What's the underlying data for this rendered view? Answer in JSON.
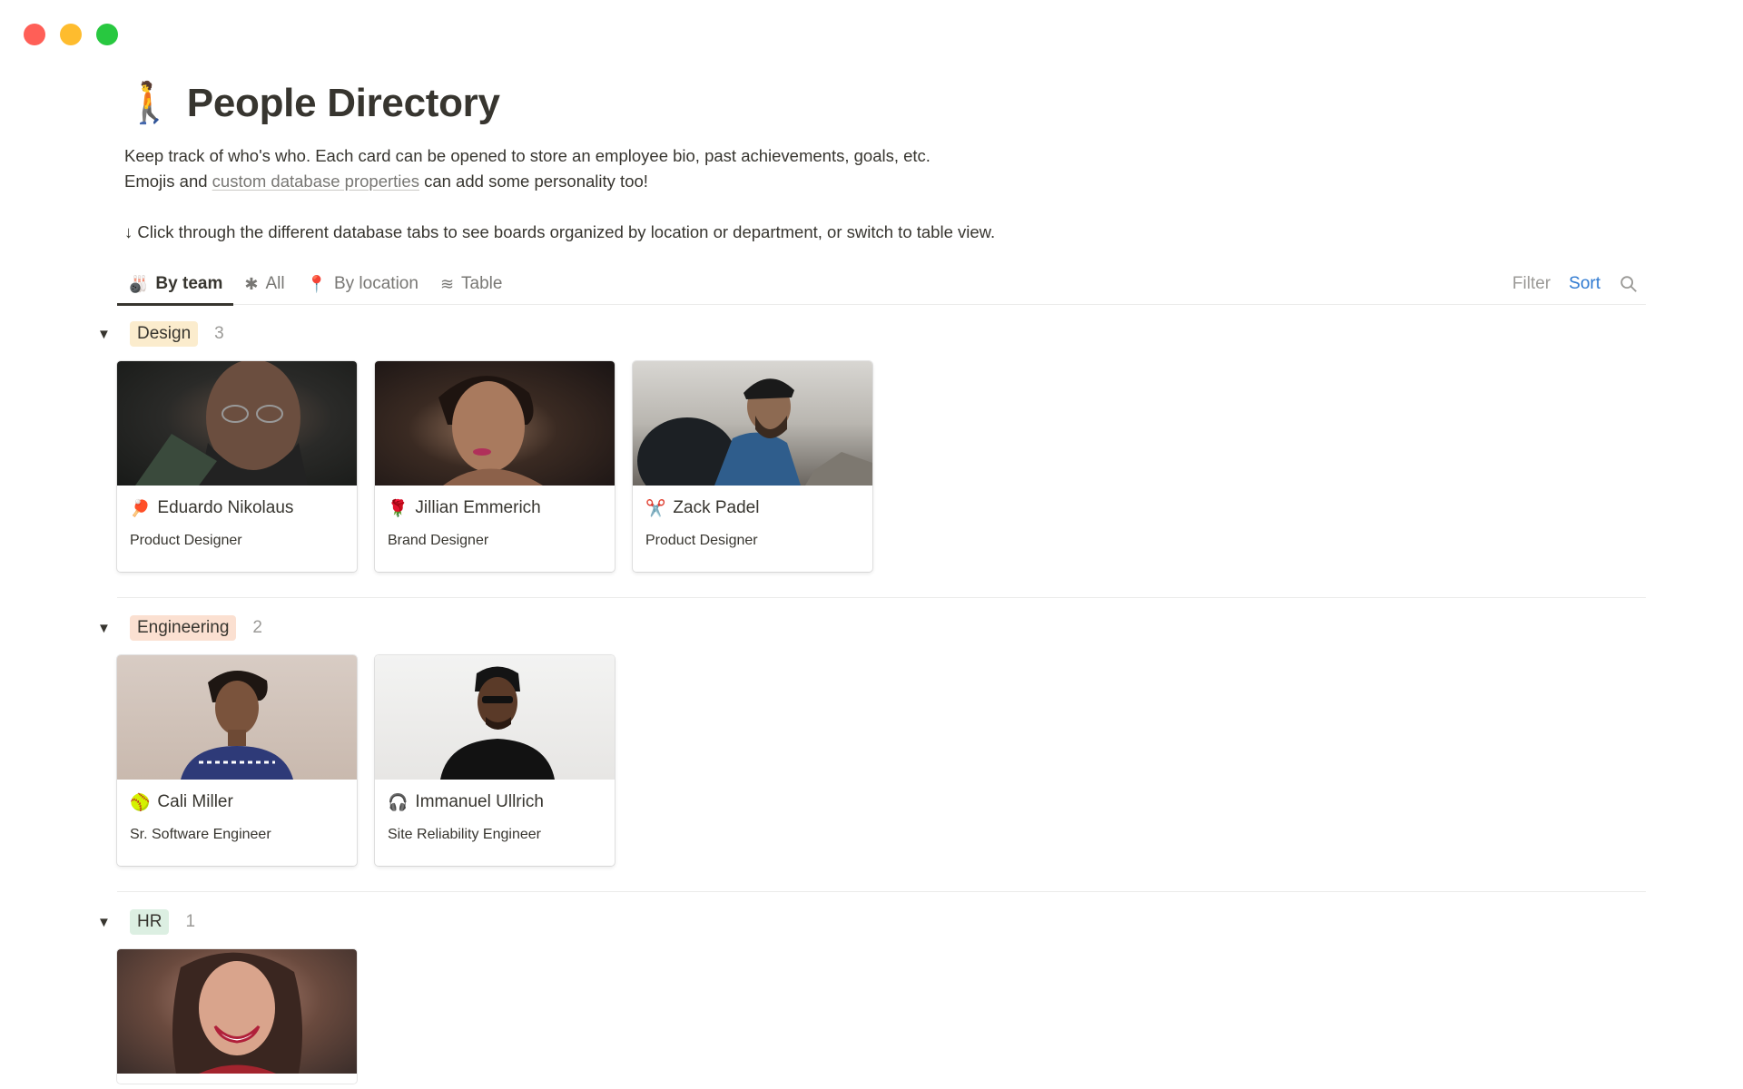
{
  "page": {
    "title_icon": "🚶",
    "title": "People Directory",
    "desc_line1": "Keep track of who's who. Each card can be opened to store an employee bio, past achievements, goals, etc.",
    "desc_line2_pre": "Emojis and ",
    "desc_line2_link": "custom database properties",
    "desc_line2_post": " can add some personality too!",
    "desc_line3": "↓ Click through the different database tabs to see boards organized by location or department, or switch to table view."
  },
  "tabs": [
    {
      "label": "By team",
      "icon": "🎳",
      "active": true
    },
    {
      "label": "All",
      "icon": "✱",
      "active": false
    },
    {
      "label": "By location",
      "icon": "📍",
      "active": false
    },
    {
      "label": "Table",
      "icon": "≋",
      "active": false
    }
  ],
  "actions": {
    "filter": "Filter",
    "sort": "Sort",
    "search_icon": "search-icon"
  },
  "groups": [
    {
      "name": "Design",
      "count": "3",
      "cards": [
        {
          "emoji": "🏓",
          "name": "Eduardo Nikolaus",
          "role": "Product Designer"
        },
        {
          "emoji": "🌹",
          "name": "Jillian Emmerich",
          "role": "Brand Designer"
        },
        {
          "emoji": "✂️",
          "name": "Zack Padel",
          "role": "Product Designer"
        }
      ]
    },
    {
      "name": "Engineering",
      "count": "2",
      "cards": [
        {
          "emoji": "🥎",
          "name": "Cali Miller",
          "role": "Sr. Software Engineer"
        },
        {
          "emoji": "🎧",
          "name": "Immanuel Ullrich",
          "role": "Site Reliability Engineer"
        }
      ]
    },
    {
      "name": "HR",
      "count": "1",
      "cards": []
    }
  ],
  "colors": {
    "design_pill": "#fbeccd",
    "engineering_pill": "#fbe0d1",
    "hr_pill": "#dcefe2",
    "sort_blue": "#2f7ad1"
  }
}
